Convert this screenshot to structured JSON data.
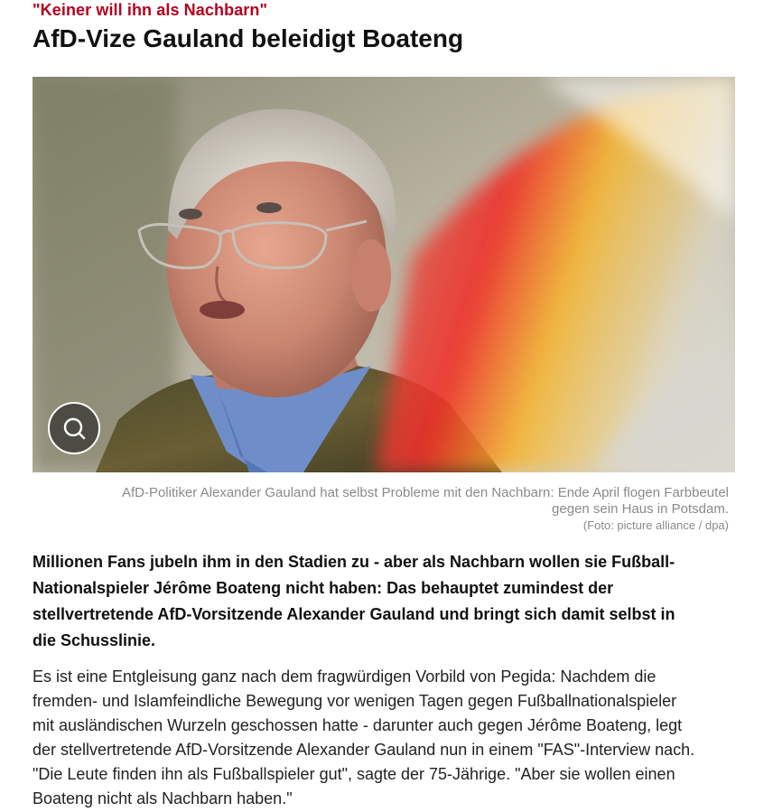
{
  "article": {
    "kicker": "\"Keiner will ihn als Nachbarn\"",
    "headline": "AfD-Vize Gauland beleidigt Boateng",
    "image": {
      "zoom_icon": "magnifier-icon",
      "caption_lines": [
        "AfD-Politiker Alexander Gauland hat selbst Probleme mit den Nachbarn: Ende April flogen Farbbeutel",
        "gegen sein Haus in Potsdam."
      ],
      "credit": "(Foto: picture alliance / dpa)"
    },
    "lead_lines": [
      "Millionen Fans jubeln ihm in den Stadien zu - aber als Nachbarn wollen sie Fußball-",
      "Nationalspieler Jérôme Boateng nicht haben: Das behauptet zumindest der",
      "stellvertretende AfD-Vorsitzende Alexander Gauland und bringt sich damit selbst in",
      "die Schusslinie."
    ],
    "body_lines": [
      "Es ist eine Entgleisung ganz nach dem fragwürdigen Vorbild von Pegida: Nachdem die",
      "fremden- und Islamfeindliche Bewegung vor wenigen Tagen gegen Fußballnationalspieler",
      "mit ausländischen Wurzeln geschossen hatte - darunter auch gegen Jérôme Boateng, legt",
      "der stellvertretende AfD-Vorsitzende Alexander Gauland nun in einem \"FAS\"-Interview nach.",
      "\"Die Leute finden ihn als Fußballspieler gut\", sagte der 75-Jährige. \"Aber sie wollen einen",
      "Boateng nicht als Nachbarn haben.\""
    ]
  },
  "colors": {
    "kicker": "#b4001e",
    "caption": "#8a8a8a",
    "text": "#111111"
  }
}
